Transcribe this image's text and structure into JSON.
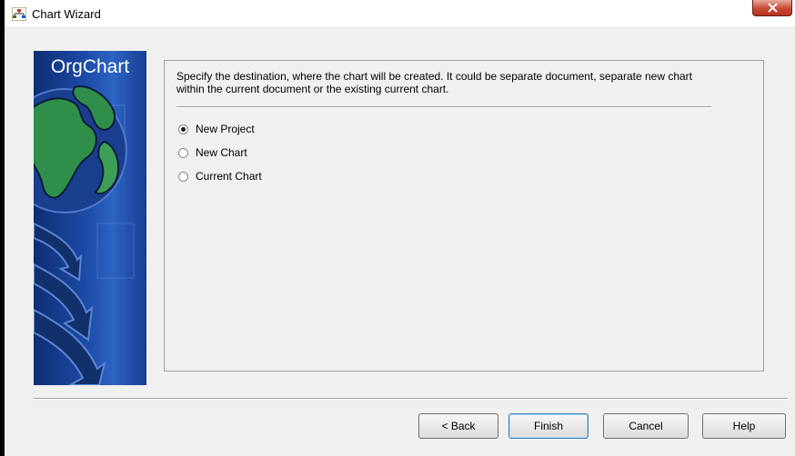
{
  "window": {
    "title": "Chart Wizard",
    "close_icon": "close-icon"
  },
  "banner": {
    "title": "OrgChart"
  },
  "main": {
    "description": "Specify the destination, where the chart will be created. It could be separate document, separate new chart within the current document or the existing current chart.",
    "options": [
      {
        "label": "New Project",
        "selected": true
      },
      {
        "label": "New Chart",
        "selected": false
      },
      {
        "label": "Current Chart",
        "selected": false
      }
    ]
  },
  "buttons": {
    "back": "< Back",
    "finish": "Finish",
    "cancel": "Cancel",
    "help": "Help"
  }
}
